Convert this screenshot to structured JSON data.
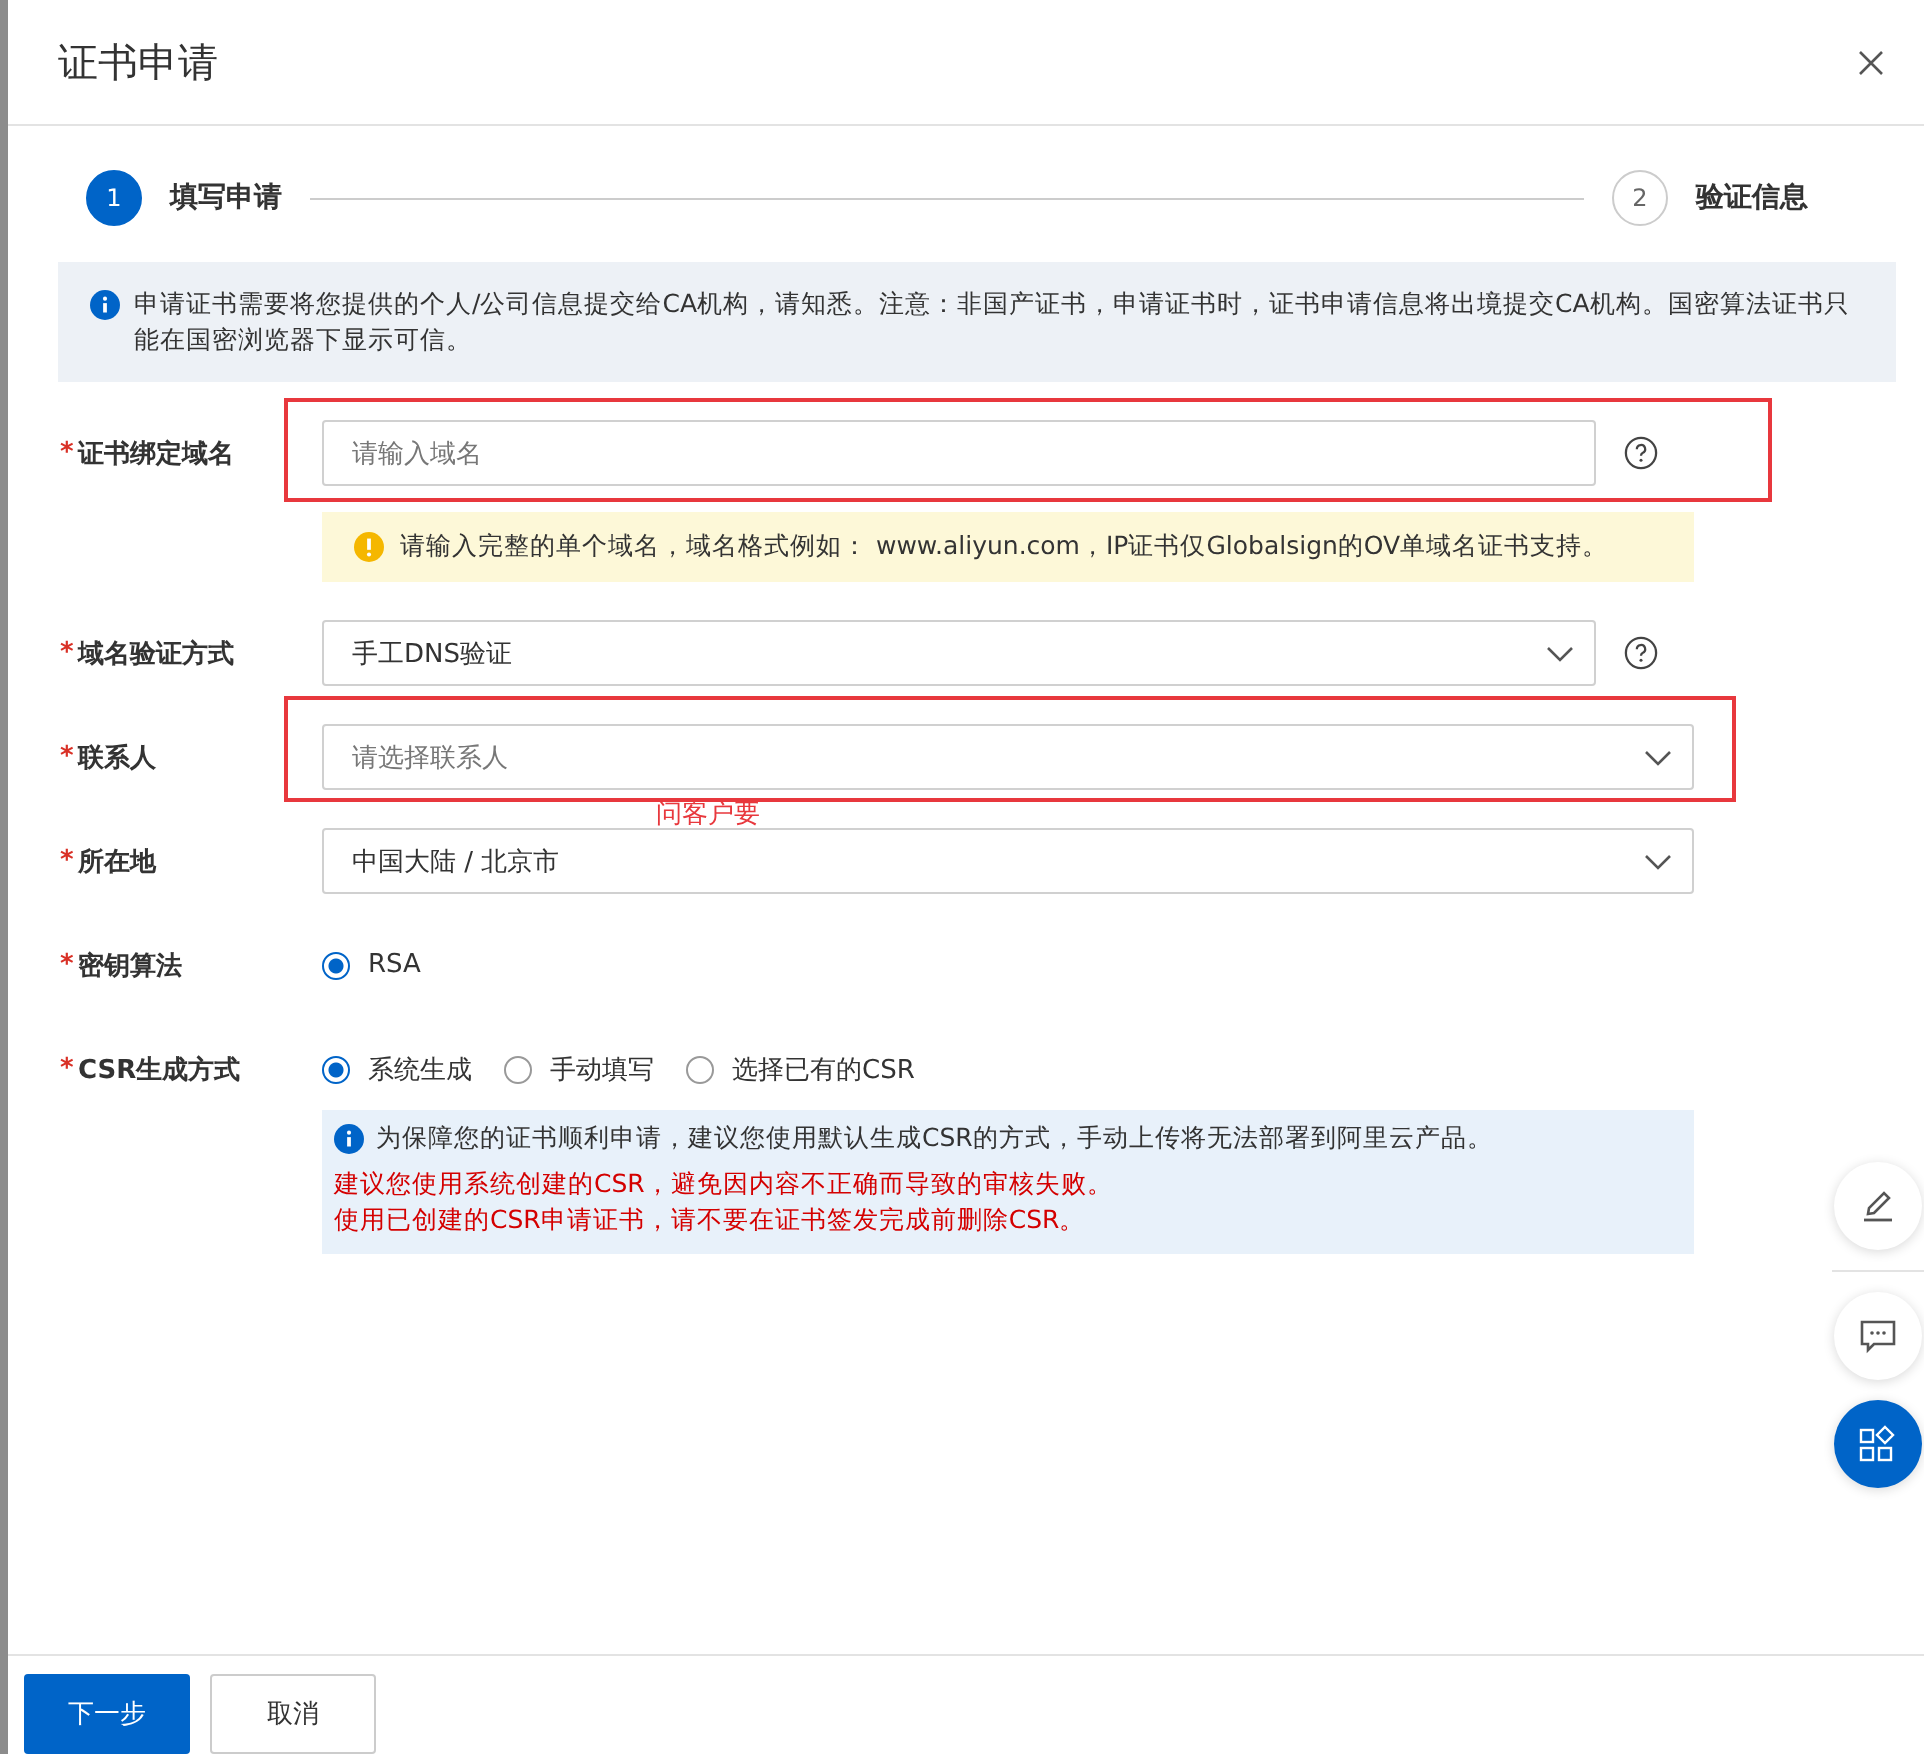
{
  "dialog": {
    "title": "证书申请"
  },
  "steps": [
    {
      "number": "1",
      "label": "填写申请",
      "selected": true
    },
    {
      "number": "2",
      "label": "验证信息",
      "selected": false
    }
  ],
  "notice": {
    "text": "申请证书需要将您提供的个人/公司信息提交给CA机构，请知悉。注意：非国产证书，申请证书时，证书申请信息将出境提交CA机构。国密算法证书只能在国密浏览器下显示可信。"
  },
  "form": [
    {
      "kind": "input",
      "label": "证书绑定域名",
      "marker": "*",
      "placeholder": "请输入域名",
      "help": true,
      "annotated": true,
      "tip": "请输入完整的单个域名，域名格式例如： www.aliyun.com，IP证书仅Globalsign的OV单域名证书支持。"
    },
    {
      "kind": "select",
      "label": "域名验证方式",
      "marker": "*",
      "value": "手工DNS验证",
      "help": true,
      "annotated": false
    },
    {
      "kind": "select",
      "label": "联系人",
      "marker": "*",
      "placeholder": "请选择联系人",
      "help": false,
      "annotated": true,
      "annotation": "问客户要"
    },
    {
      "kind": "select",
      "label": "所在地",
      "marker": "*",
      "value": "中国大陆 / 北京市",
      "help": false,
      "annotated": false
    },
    {
      "kind": "radio",
      "label": "密钥算法",
      "marker": "*",
      "options": [
        {
          "label": "RSA",
          "selected": true
        }
      ]
    },
    {
      "kind": "radio",
      "label": "CSR生成方式",
      "marker": "*",
      "options": [
        {
          "label": "系统生成",
          "selected": true
        },
        {
          "label": "手动填写",
          "selected": false
        },
        {
          "label": "选择已有的CSR",
          "selected": false
        }
      ],
      "note": {
        "info": "为保障您的证书顺利申请，建议您使用默认生成CSR的方式，手动上传将无法部署到阿里云产品。",
        "warnings": [
          "建议您使用系统创建的CSR，避免因内容不正确而导致的审核失败。",
          "使用已创建的CSR申请证书，请不要在证书签发完成前删除CSR。"
        ]
      }
    }
  ],
  "buttons": [
    {
      "label": "下一步",
      "kind": "primary"
    },
    {
      "label": "取消",
      "kind": "default"
    }
  ]
}
